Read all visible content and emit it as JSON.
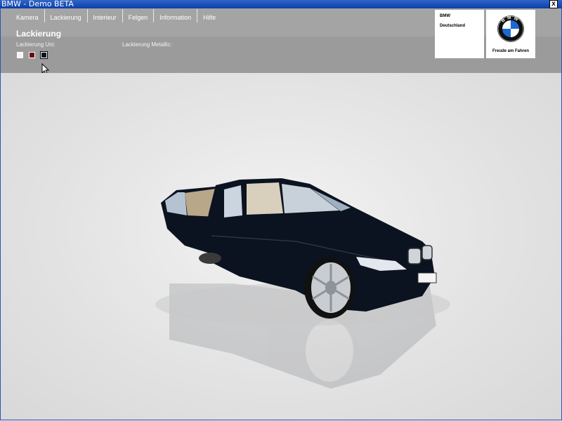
{
  "window": {
    "title": "BMW - Demo BETA",
    "close_glyph": "x"
  },
  "menu": {
    "items": [
      {
        "label": "Kamera"
      },
      {
        "label": "Lackierung"
      },
      {
        "label": "Interieur"
      },
      {
        "label": "Felgen"
      },
      {
        "label": "Information"
      },
      {
        "label": "Hilfe"
      }
    ]
  },
  "section": {
    "title": "Lackierung",
    "uni_label": "Lackierung Uni:",
    "metallic_label": "Lackierung Metallic:"
  },
  "swatches": [
    {
      "name": "white",
      "color": "#f4f4f4"
    },
    {
      "name": "dark-red",
      "color": "#6a0a14"
    },
    {
      "name": "black",
      "color": "#0b1426",
      "selected": true
    }
  ],
  "brand": {
    "name_line1": "BMW",
    "name_line2": "Deutschland",
    "slogan": "Freude am Fahren",
    "logo_letters": "BMW",
    "logo_colors": {
      "blue": "#1c69d4",
      "black": "#111111",
      "white": "#ffffff"
    }
  },
  "viewer": {
    "car_color": "#0b1220",
    "subject": "3D car model"
  }
}
